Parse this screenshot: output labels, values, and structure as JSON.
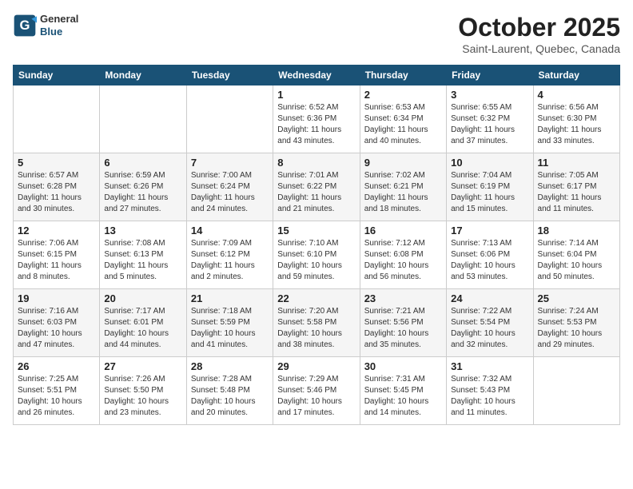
{
  "header": {
    "logo_line1": "General",
    "logo_line2": "Blue",
    "month": "October 2025",
    "location": "Saint-Laurent, Quebec, Canada"
  },
  "weekdays": [
    "Sunday",
    "Monday",
    "Tuesday",
    "Wednesday",
    "Thursday",
    "Friday",
    "Saturday"
  ],
  "weeks": [
    [
      {
        "day": "",
        "info": ""
      },
      {
        "day": "",
        "info": ""
      },
      {
        "day": "",
        "info": ""
      },
      {
        "day": "1",
        "info": "Sunrise: 6:52 AM\nSunset: 6:36 PM\nDaylight: 11 hours\nand 43 minutes."
      },
      {
        "day": "2",
        "info": "Sunrise: 6:53 AM\nSunset: 6:34 PM\nDaylight: 11 hours\nand 40 minutes."
      },
      {
        "day": "3",
        "info": "Sunrise: 6:55 AM\nSunset: 6:32 PM\nDaylight: 11 hours\nand 37 minutes."
      },
      {
        "day": "4",
        "info": "Sunrise: 6:56 AM\nSunset: 6:30 PM\nDaylight: 11 hours\nand 33 minutes."
      }
    ],
    [
      {
        "day": "5",
        "info": "Sunrise: 6:57 AM\nSunset: 6:28 PM\nDaylight: 11 hours\nand 30 minutes."
      },
      {
        "day": "6",
        "info": "Sunrise: 6:59 AM\nSunset: 6:26 PM\nDaylight: 11 hours\nand 27 minutes."
      },
      {
        "day": "7",
        "info": "Sunrise: 7:00 AM\nSunset: 6:24 PM\nDaylight: 11 hours\nand 24 minutes."
      },
      {
        "day": "8",
        "info": "Sunrise: 7:01 AM\nSunset: 6:22 PM\nDaylight: 11 hours\nand 21 minutes."
      },
      {
        "day": "9",
        "info": "Sunrise: 7:02 AM\nSunset: 6:21 PM\nDaylight: 11 hours\nand 18 minutes."
      },
      {
        "day": "10",
        "info": "Sunrise: 7:04 AM\nSunset: 6:19 PM\nDaylight: 11 hours\nand 15 minutes."
      },
      {
        "day": "11",
        "info": "Sunrise: 7:05 AM\nSunset: 6:17 PM\nDaylight: 11 hours\nand 11 minutes."
      }
    ],
    [
      {
        "day": "12",
        "info": "Sunrise: 7:06 AM\nSunset: 6:15 PM\nDaylight: 11 hours\nand 8 minutes."
      },
      {
        "day": "13",
        "info": "Sunrise: 7:08 AM\nSunset: 6:13 PM\nDaylight: 11 hours\nand 5 minutes."
      },
      {
        "day": "14",
        "info": "Sunrise: 7:09 AM\nSunset: 6:12 PM\nDaylight: 11 hours\nand 2 minutes."
      },
      {
        "day": "15",
        "info": "Sunrise: 7:10 AM\nSunset: 6:10 PM\nDaylight: 10 hours\nand 59 minutes."
      },
      {
        "day": "16",
        "info": "Sunrise: 7:12 AM\nSunset: 6:08 PM\nDaylight: 10 hours\nand 56 minutes."
      },
      {
        "day": "17",
        "info": "Sunrise: 7:13 AM\nSunset: 6:06 PM\nDaylight: 10 hours\nand 53 minutes."
      },
      {
        "day": "18",
        "info": "Sunrise: 7:14 AM\nSunset: 6:04 PM\nDaylight: 10 hours\nand 50 minutes."
      }
    ],
    [
      {
        "day": "19",
        "info": "Sunrise: 7:16 AM\nSunset: 6:03 PM\nDaylight: 10 hours\nand 47 minutes."
      },
      {
        "day": "20",
        "info": "Sunrise: 7:17 AM\nSunset: 6:01 PM\nDaylight: 10 hours\nand 44 minutes."
      },
      {
        "day": "21",
        "info": "Sunrise: 7:18 AM\nSunset: 5:59 PM\nDaylight: 10 hours\nand 41 minutes."
      },
      {
        "day": "22",
        "info": "Sunrise: 7:20 AM\nSunset: 5:58 PM\nDaylight: 10 hours\nand 38 minutes."
      },
      {
        "day": "23",
        "info": "Sunrise: 7:21 AM\nSunset: 5:56 PM\nDaylight: 10 hours\nand 35 minutes."
      },
      {
        "day": "24",
        "info": "Sunrise: 7:22 AM\nSunset: 5:54 PM\nDaylight: 10 hours\nand 32 minutes."
      },
      {
        "day": "25",
        "info": "Sunrise: 7:24 AM\nSunset: 5:53 PM\nDaylight: 10 hours\nand 29 minutes."
      }
    ],
    [
      {
        "day": "26",
        "info": "Sunrise: 7:25 AM\nSunset: 5:51 PM\nDaylight: 10 hours\nand 26 minutes."
      },
      {
        "day": "27",
        "info": "Sunrise: 7:26 AM\nSunset: 5:50 PM\nDaylight: 10 hours\nand 23 minutes."
      },
      {
        "day": "28",
        "info": "Sunrise: 7:28 AM\nSunset: 5:48 PM\nDaylight: 10 hours\nand 20 minutes."
      },
      {
        "day": "29",
        "info": "Sunrise: 7:29 AM\nSunset: 5:46 PM\nDaylight: 10 hours\nand 17 minutes."
      },
      {
        "day": "30",
        "info": "Sunrise: 7:31 AM\nSunset: 5:45 PM\nDaylight: 10 hours\nand 14 minutes."
      },
      {
        "day": "31",
        "info": "Sunrise: 7:32 AM\nSunset: 5:43 PM\nDaylight: 10 hours\nand 11 minutes."
      },
      {
        "day": "",
        "info": ""
      }
    ]
  ]
}
